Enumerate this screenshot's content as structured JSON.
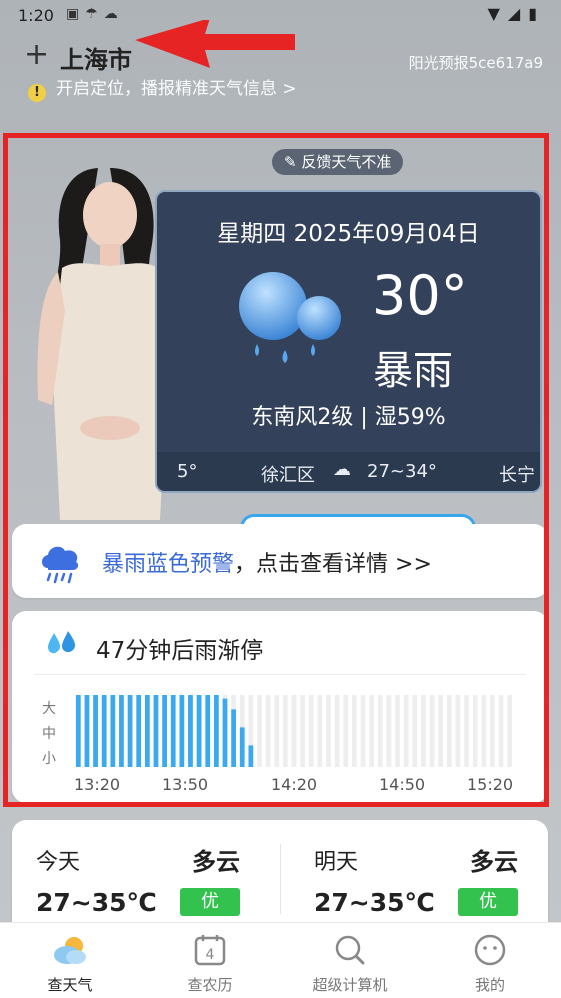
{
  "status_bar": {
    "time": "1:20",
    "left_icons": [
      "app-icon",
      "cloud-rain-icon",
      "cloud-icon"
    ],
    "right_icons": [
      "wifi-icon",
      "signal-icon",
      "battery-icon"
    ]
  },
  "header": {
    "add_symbol": "+",
    "city": "上海市",
    "brand": "阳光预报5ce617a9",
    "locate_text": "开启定位，播报精准天气信息 >",
    "warn_symbol": "!"
  },
  "feedback": {
    "label": "反馈天气不准",
    "icon": "edit-icon"
  },
  "weather_card": {
    "date": "星期四   2025年09月04日",
    "temperature": "30°",
    "condition": "暴雨",
    "wind_humidity": "东南风2级 | 湿59%",
    "ticker": [
      {
        "text": "5°"
      },
      {
        "text": "徐汇区"
      },
      {
        "text": "27~34°"
      },
      {
        "text": "长宁"
      }
    ]
  },
  "alert": {
    "title": "暴雨蓝色预警",
    "suffix": "，点击查看详情 >>"
  },
  "rain": {
    "title": "47分钟后雨渐停",
    "scale": [
      "大",
      "中",
      "小"
    ],
    "times": [
      "13:20",
      "13:50",
      "14:20",
      "14:50",
      "15:20"
    ],
    "intensity": [
      1,
      1,
      1,
      1,
      1,
      1,
      1,
      1,
      1,
      1,
      1,
      1,
      1,
      1,
      1,
      1,
      1,
      0.95,
      0.8,
      0.55,
      0.3,
      0,
      0,
      0,
      0,
      0,
      0,
      0,
      0,
      0,
      0,
      0,
      0,
      0,
      0,
      0,
      0,
      0,
      0,
      0,
      0,
      0,
      0,
      0,
      0,
      0,
      0,
      0,
      0,
      0,
      0
    ]
  },
  "forecast": {
    "today": {
      "label": "今天",
      "condition": "多云",
      "temp": "27~35℃",
      "aqi": "优"
    },
    "tomorrow": {
      "label": "明天",
      "condition": "多云",
      "temp": "27~35℃",
      "aqi": "优"
    }
  },
  "tabs": [
    {
      "label": "查天气",
      "icon": "weather-icon",
      "active": true
    },
    {
      "label": "查农历",
      "icon": "calendar-icon",
      "day": "4",
      "active": false
    },
    {
      "label": "超级计算机",
      "icon": "search-icon",
      "active": false
    },
    {
      "label": "我的",
      "icon": "profile-icon",
      "active": false
    }
  ],
  "colors": {
    "accent_red": "#e62424",
    "card_bg": "#33415a",
    "rain_bar": "#3aa9ef",
    "aqi_good": "#32c24d",
    "alert_blue": "#3b6bd6"
  }
}
